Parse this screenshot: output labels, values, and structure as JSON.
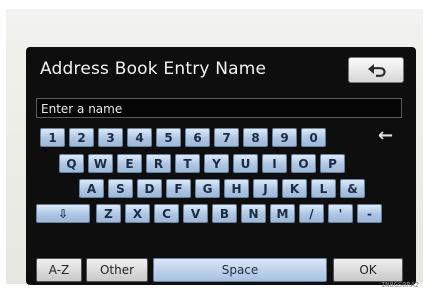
{
  "screen": {
    "title": "Address Book Entry Name",
    "back_icon": "return-arrow-icon"
  },
  "name_input": {
    "placeholder": "Enter a name",
    "value": ""
  },
  "keyboard": {
    "row1": [
      "1",
      "2",
      "3",
      "4",
      "5",
      "6",
      "7",
      "8",
      "9",
      "0"
    ],
    "backspace_glyph": "←",
    "row2": [
      "Q",
      "W",
      "E",
      "R",
      "T",
      "Y",
      "U",
      "I",
      "O",
      "P"
    ],
    "row3": [
      "A",
      "S",
      "D",
      "F",
      "G",
      "H",
      "J",
      "K",
      "L",
      "&"
    ],
    "shift_glyph": "⇩",
    "row4": [
      "Z",
      "X",
      "C",
      "V",
      "B",
      "N",
      "M",
      "/",
      "'",
      "-"
    ]
  },
  "bottom_bar": {
    "az_label": "A-Z",
    "other_label": "Other",
    "space_label": "Space",
    "ok_label": "OK"
  },
  "footer": {
    "code": "IN8GS0RA2"
  },
  "colors": {
    "key_fill": "#aec6e3",
    "screen_bg": "#0e0e0e",
    "title_text": "#f2f2f2"
  }
}
